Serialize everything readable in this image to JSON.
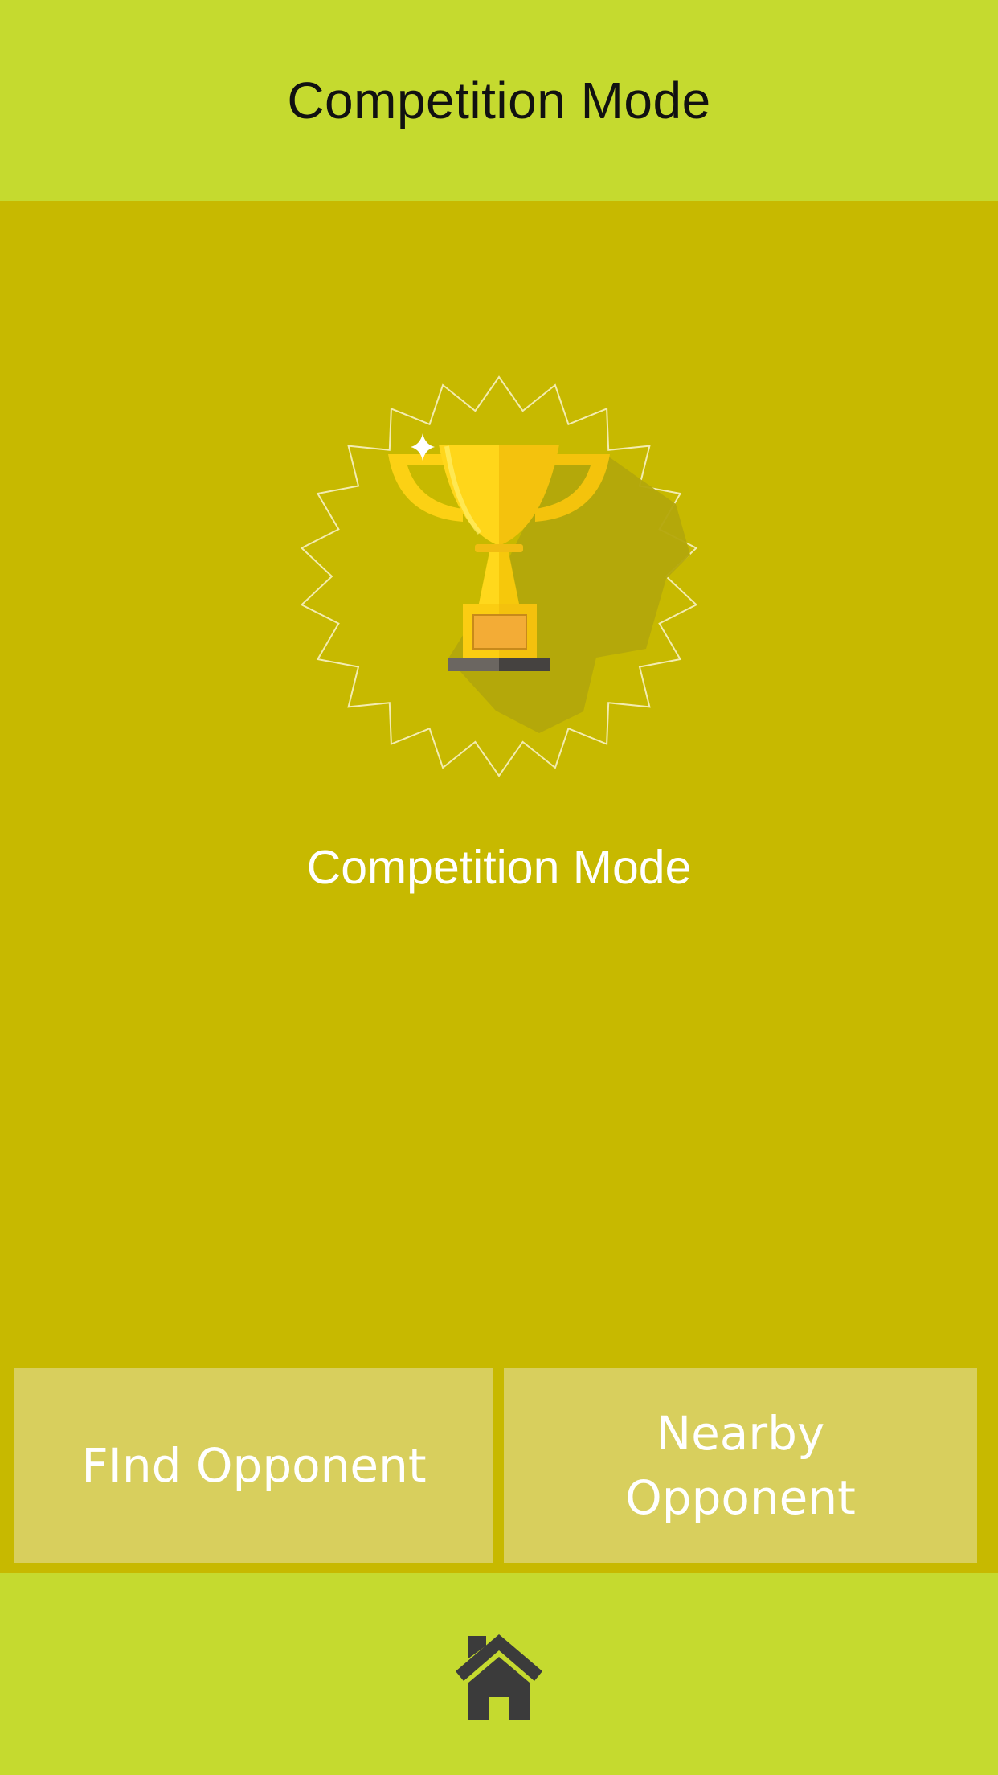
{
  "header": {
    "title": "Competition Mode"
  },
  "main": {
    "emblem_icon": "trophy-icon",
    "mode_label": "Competition Mode"
  },
  "actions": {
    "find_opponent": "FInd Opponent",
    "nearby_opponent": "Nearby Opponent"
  },
  "footer": {
    "home_icon": "home-icon"
  },
  "colors": {
    "header_bg": "#c5da2f",
    "main_bg": "#c7b900",
    "button_bg": "#d8cf5d",
    "trophy_gold": "#f6c80b",
    "plaque": "#f3ac36",
    "home_icon": "#3b3b3b"
  }
}
